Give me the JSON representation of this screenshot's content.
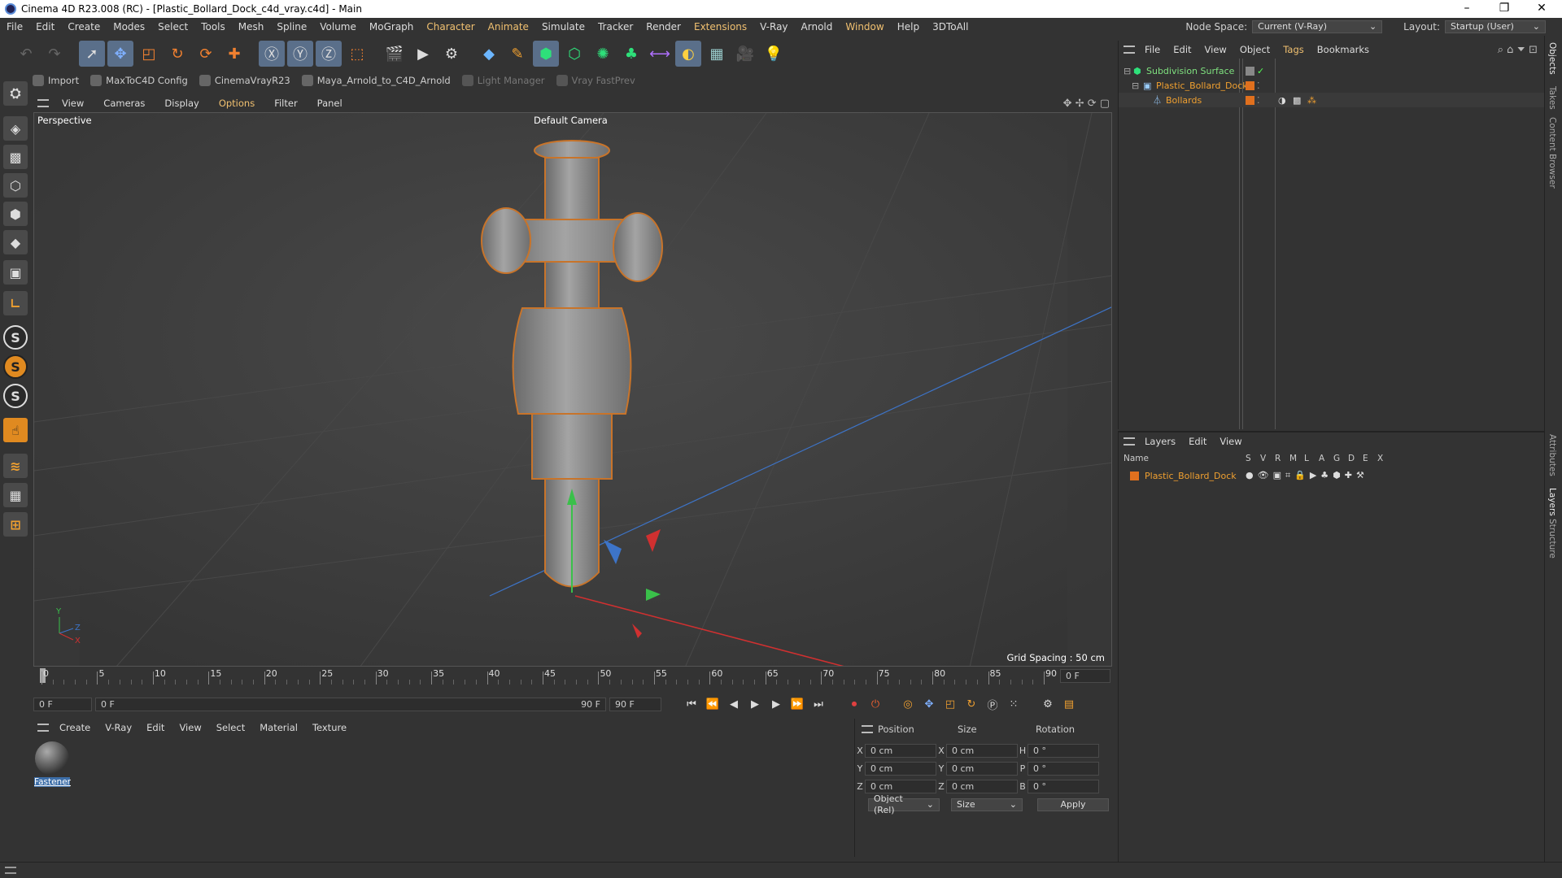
{
  "window": {
    "title": "Cinema 4D R23.008 (RC) - [Plastic_Bollard_Dock_c4d_vray.c4d] - Main",
    "min": "–",
    "max": "❐",
    "close": "✕"
  },
  "menu": {
    "items": [
      "File",
      "Edit",
      "Create",
      "Modes",
      "Select",
      "Tools",
      "Mesh",
      "Spline",
      "Volume",
      "MoGraph",
      "Character",
      "Animate",
      "Simulate",
      "Tracker",
      "Render",
      "Extensions",
      "V-Ray",
      "Arnold",
      "Window",
      "Help",
      "3DToAll"
    ],
    "node_space_label": "Node Space:",
    "node_space_value": "Current (V-Ray)",
    "layout_label": "Layout:",
    "layout_value": "Startup (User)"
  },
  "plugins": {
    "import": "Import",
    "maxtoc4d": "MaxToC4D Config",
    "cinemavray": "CinemaVrayR23",
    "mayaarnold": "Maya_Arnold_to_C4D_Arnold",
    "lightmanager": "Light Manager",
    "vrayfast": "Vray FastPrev"
  },
  "viewport_menu": [
    "View",
    "Cameras",
    "Display",
    "Options",
    "Filter",
    "Panel"
  ],
  "viewport": {
    "label": "Perspective",
    "camera": "Default Camera",
    "grid": "Grid Spacing : 50 cm"
  },
  "timeline": {
    "ticks": [
      "0",
      "5",
      "10",
      "15",
      "20",
      "25",
      "30",
      "35",
      "40",
      "45",
      "50",
      "55",
      "60",
      "65",
      "70",
      "75",
      "80",
      "85",
      "90"
    ],
    "current": "0 F",
    "start": "0 F",
    "range_start": "0 F",
    "range_end": "90 F",
    "end": "90 F"
  },
  "material_menu": [
    "Create",
    "V-Ray",
    "Edit",
    "View",
    "Select",
    "Material",
    "Texture"
  ],
  "material": {
    "name": "Fastener"
  },
  "coords": {
    "position": "Position",
    "size": "Size",
    "rotation": "Rotation",
    "rows": [
      {
        "a": "X",
        "p": "0 cm",
        "b": "X",
        "s": "0 cm",
        "c": "H",
        "r": "0 °"
      },
      {
        "a": "Y",
        "p": "0 cm",
        "b": "Y",
        "s": "0 cm",
        "c": "P",
        "r": "0 °"
      },
      {
        "a": "Z",
        "p": "0 cm",
        "b": "Z",
        "s": "0 cm",
        "c": "B",
        "r": "0 °"
      }
    ],
    "mode": "Object (Rel)",
    "size_mode": "Size",
    "apply": "Apply"
  },
  "objects": {
    "menu": [
      "File",
      "Edit",
      "View",
      "Object",
      "Tags",
      "Bookmarks"
    ],
    "items": [
      {
        "name": "Subdivision Surface"
      },
      {
        "name": "Plastic_Bollard_Dock"
      },
      {
        "name": "Bollards"
      }
    ]
  },
  "layers": {
    "menu": [
      "Layers",
      "Edit",
      "View"
    ],
    "name_header": "Name",
    "cols": [
      "S",
      "V",
      "R",
      "M",
      "L",
      "A",
      "G",
      "D",
      "E",
      "X"
    ],
    "items": [
      {
        "name": "Plastic_Bollard_Dock"
      }
    ]
  },
  "sidetabs": [
    "Objects",
    "Takes",
    "Content Browser",
    "Attributes",
    "Layers",
    "Structure"
  ]
}
